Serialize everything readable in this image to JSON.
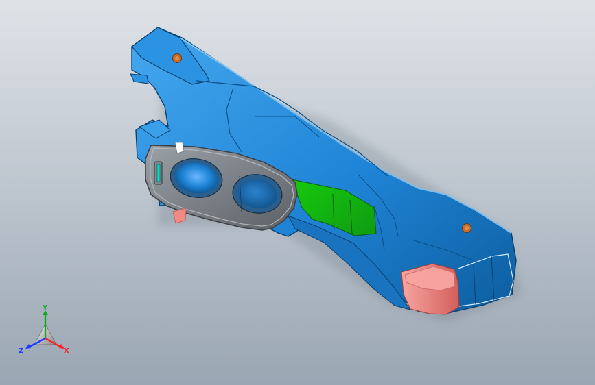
{
  "viewport": {
    "background_top": "#dfe3e8",
    "background_bottom": "#9aa6b3"
  },
  "part": {
    "body_color": "#1f84d6",
    "body_highlight": "#45a8ef",
    "body_shadow": "#0d5d9e",
    "face_green": "#16c90d",
    "face_green_dark": "#0f9b12",
    "face_red": "#f07f7a",
    "face_red_dark": "#d35e5a",
    "plate_color": "#6f7479",
    "plate_highlight": "#9aa1a7",
    "hole_rim": "#0e6fb8",
    "bolt_color": "#c86e2c"
  },
  "triad": {
    "x_label": "X",
    "y_label": "Y",
    "z_label": "Z",
    "x_color": "#ff1d25",
    "y_color": "#11aa22",
    "z_color": "#1f3dff"
  }
}
